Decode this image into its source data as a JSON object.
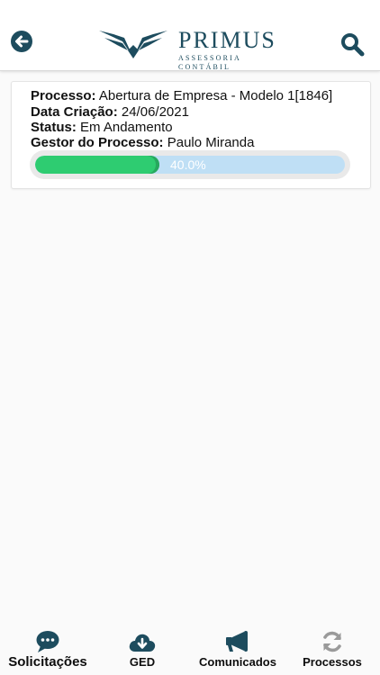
{
  "header": {
    "brand_name": "PRIMUS",
    "brand_tagline": "ASSESSORIA CONTÁBIL",
    "back_icon": "arrow-left-circle-icon",
    "search_icon": "search-icon",
    "colors": {
      "brand": "#1d4c5e"
    }
  },
  "process": {
    "processo_label": "Processo:",
    "processo_value": "Abertura de Empresa - Modelo 1[1846]",
    "data_label": "Data Criação:",
    "data_value": "24/06/2021",
    "status_label": "Status:",
    "status_value": "Em Andamento",
    "gestor_label": "Gestor do Processo:",
    "gestor_value": "Paulo Miranda",
    "progress_percent": 40.0,
    "progress_text": "40.0%",
    "colors": {
      "fill": "#2ecc71",
      "track": "#bfdff5"
    }
  },
  "tabs": [
    {
      "label": "Solicitações",
      "icon": "chat-bubble-icon",
      "active": true
    },
    {
      "label": "GED",
      "icon": "cloud-download-icon",
      "active": false
    },
    {
      "label": "Comunicados",
      "icon": "megaphone-icon",
      "active": false
    },
    {
      "label": "Processos",
      "icon": "sync-icon",
      "active": false
    }
  ]
}
